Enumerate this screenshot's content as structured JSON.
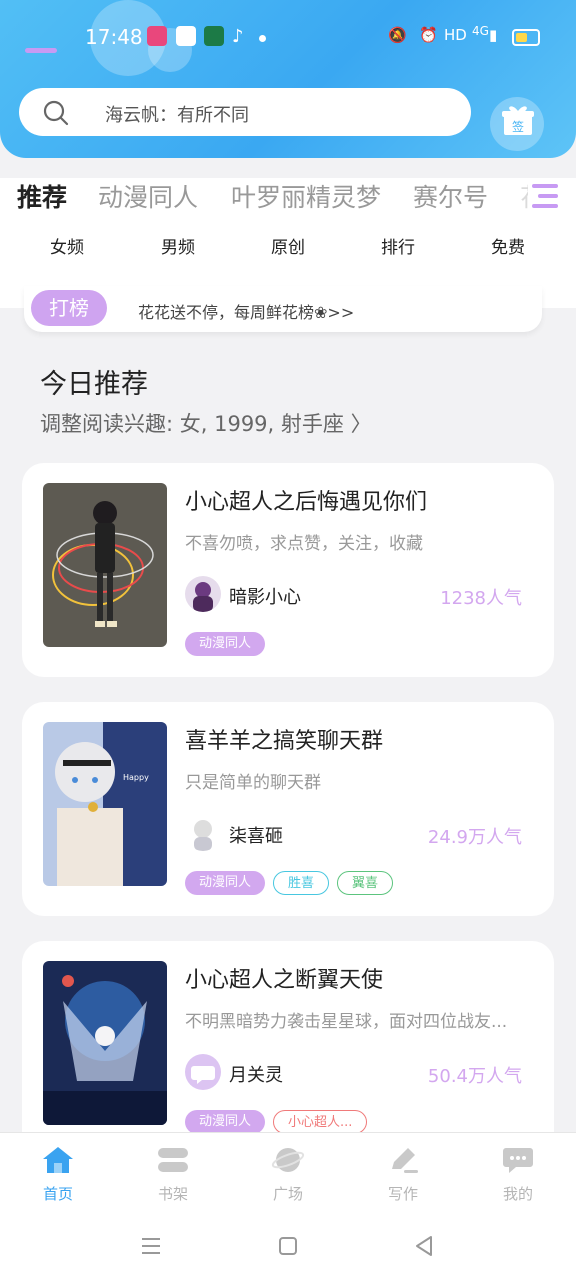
{
  "status_bar": {
    "time": "17:48",
    "network": "HD",
    "signal": "4G"
  },
  "search": {
    "placeholder": "海云帆：有所不同"
  },
  "checkin": {
    "label": "签"
  },
  "tabs": [
    "推荐",
    "动漫同人",
    "叶罗丽精灵梦",
    "赛尔号",
    "花"
  ],
  "subtabs": [
    "女频",
    "男频",
    "原创",
    "排行",
    "免费"
  ],
  "rank_banner": {
    "badge": "打榜",
    "text": "花花送不停，每周鲜花榜❀>>"
  },
  "section": {
    "title": "今日推荐",
    "subtitle": "调整阅读兴趣: 女, 1999, 射手座 〉"
  },
  "books": [
    {
      "title": "小心超人之后悔遇见你们",
      "desc": "不喜勿喷，求点赞，关注，收藏",
      "author": "暗影小心",
      "popularity": "1238人气",
      "tags": [
        "动漫同人"
      ]
    },
    {
      "title": "喜羊羊之搞笑聊天群",
      "desc": "只是简单的聊天群",
      "author": "柒喜砸",
      "popularity": "24.9万人气",
      "tags": [
        "动漫同人",
        "胜喜",
        "翼喜"
      ]
    },
    {
      "title": "小心超人之断翼天使",
      "desc": "不明黑暗势力袭击星星球，面对四位战友...",
      "author": "月关灵",
      "popularity": "50.4万人气",
      "tags": [
        "动漫同人",
        "小心超人..."
      ]
    }
  ],
  "bottom_nav": [
    "首页",
    "书架",
    "广场",
    "写作",
    "我的"
  ],
  "colors": {
    "accent": "#3aa3f0",
    "purple": "#cfa4f0",
    "header": "#46b4f4"
  }
}
